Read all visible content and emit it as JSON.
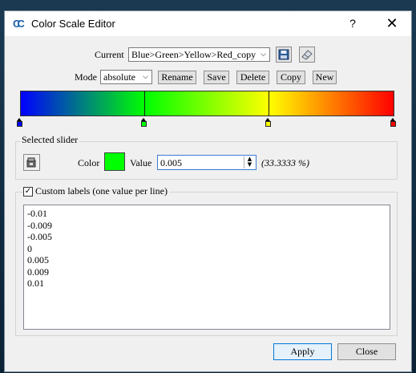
{
  "window": {
    "title": "Color Scale Editor",
    "help": "?",
    "close": "✕",
    "app_icon": "CC"
  },
  "current": {
    "label": "Current",
    "value": "Blue>Green>Yellow>Red_copy"
  },
  "mode": {
    "label": "Mode",
    "value": "absolute"
  },
  "buttons": {
    "rename": "Rename",
    "save": "Save",
    "delete": "Delete",
    "copy": "Copy",
    "new": "New"
  },
  "scale": {
    "stops": [
      {
        "position": 0.0,
        "color": "#0000ff"
      },
      {
        "position": 0.3333,
        "color": "#00ff00"
      },
      {
        "position": 0.6667,
        "color": "#ffff00"
      },
      {
        "position": 1.0,
        "color": "#ff0000"
      }
    ],
    "selected_stop": 1
  },
  "selected_slider": {
    "title": "Selected slider",
    "color_label": "Color",
    "color": "#00ff00",
    "value_label": "Value",
    "value": "0.005",
    "percent": "(33.3333 %)"
  },
  "custom_labels": {
    "label": "Custom labels (one value per line)",
    "checked": true,
    "lines": [
      "-0.01",
      "-0.009",
      "-0.005",
      "0",
      "0.005",
      "0.009",
      "0.01"
    ]
  },
  "footer": {
    "apply": "Apply",
    "close": "Close"
  }
}
